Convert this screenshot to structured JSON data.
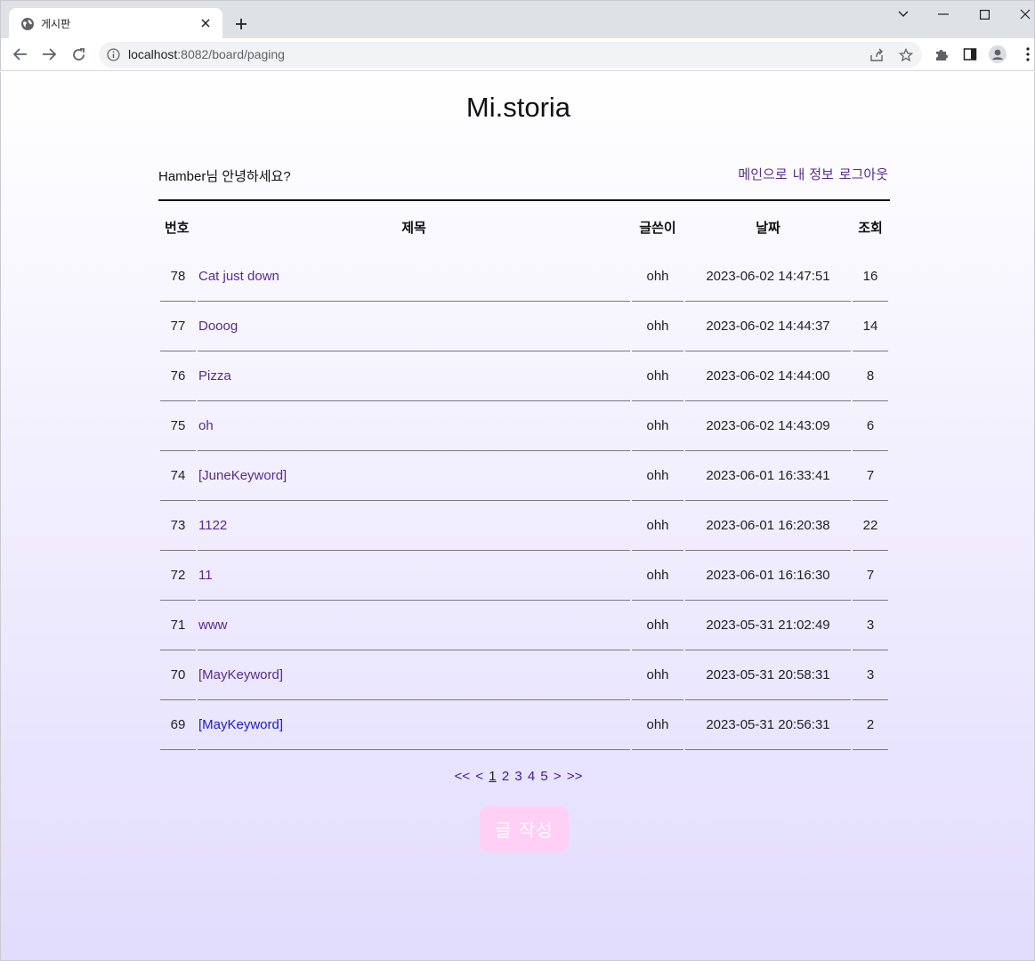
{
  "browser": {
    "tab_title": "게시판",
    "url_host": "localhost",
    "url_path": ":8082/board/paging"
  },
  "site": {
    "title": "Mi.storia",
    "greeting": "Hamber님 안녕하세요?",
    "links": [
      "메인으로",
      "내 정보",
      "로그아웃"
    ]
  },
  "table": {
    "headers": [
      "번호",
      "제목",
      "글쓴이",
      "날짜",
      "조회"
    ],
    "rows": [
      {
        "no": "78",
        "title": "Cat just down",
        "author": "ohh",
        "date": "2023-06-02 14:47:51",
        "views": "16"
      },
      {
        "no": "77",
        "title": "Dooog",
        "author": "ohh",
        "date": "2023-06-02 14:44:37",
        "views": "14"
      },
      {
        "no": "76",
        "title": "Pizza",
        "author": "ohh",
        "date": "2023-06-02 14:44:00",
        "views": "8"
      },
      {
        "no": "75",
        "title": "oh",
        "author": "ohh",
        "date": "2023-06-02 14:43:09",
        "views": "6"
      },
      {
        "no": "74",
        "title": "[JuneKeyword]",
        "author": "ohh",
        "date": "2023-06-01 16:33:41",
        "views": "7"
      },
      {
        "no": "73",
        "title": "1122",
        "author": "ohh",
        "date": "2023-06-01 16:20:38",
        "views": "22"
      },
      {
        "no": "72",
        "title": "11",
        "author": "ohh",
        "date": "2023-06-01 16:16:30",
        "views": "7"
      },
      {
        "no": "71",
        "title": "www",
        "author": "ohh",
        "date": "2023-05-31 21:02:49",
        "views": "3"
      },
      {
        "no": "70",
        "title": "[MayKeyword]",
        "author": "ohh",
        "date": "2023-05-31 20:58:31",
        "views": "3"
      },
      {
        "no": "69",
        "title": "[MayKeyword]",
        "author": "ohh",
        "date": "2023-05-31 20:56:31",
        "views": "2"
      }
    ]
  },
  "pager": {
    "first": "<<",
    "prev": "<",
    "pages": [
      "1",
      "2",
      "3",
      "4",
      "5"
    ],
    "current": "1",
    "next": ">",
    "last": ">>"
  },
  "write_button": "글 작성",
  "colors": {
    "link": "#5a2a8c",
    "visited_link": "#1a1ad0",
    "write_button_bg": "#ffcff5",
    "gradient_end": "#e2dcfd"
  }
}
